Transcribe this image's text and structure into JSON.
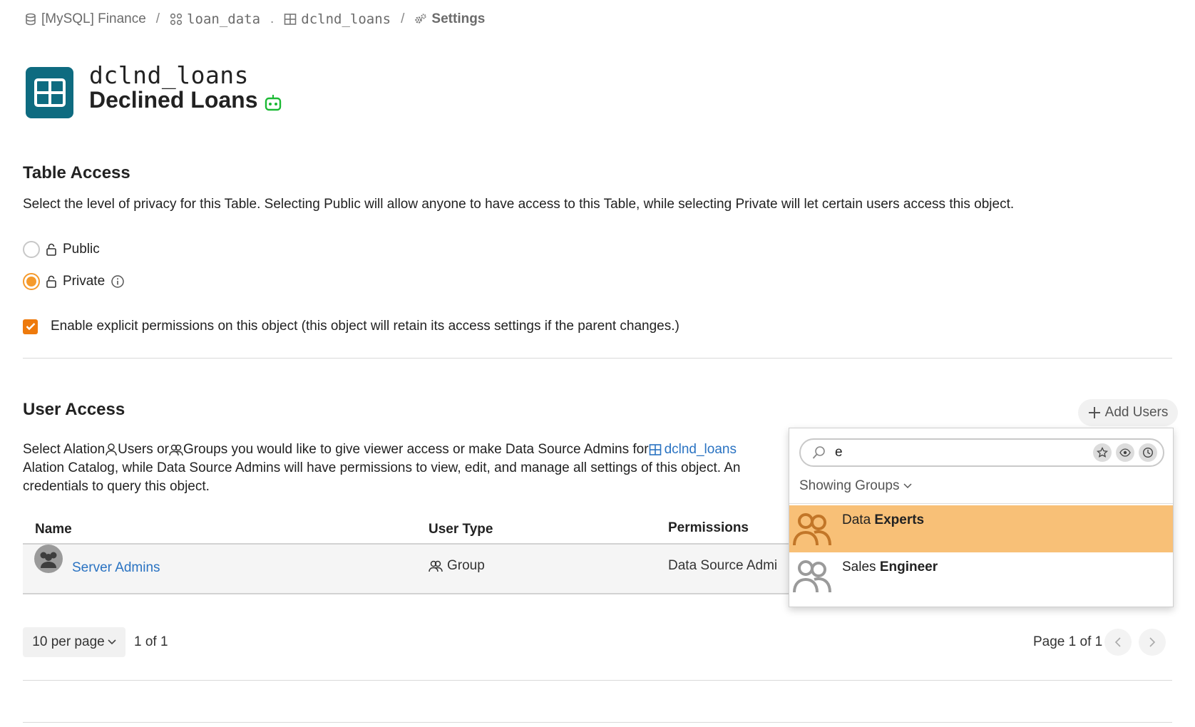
{
  "breadcrumb": {
    "datasource": "[MySQL] Finance",
    "schema": "loan_data",
    "dot": ".",
    "table": "dclnd_loans",
    "current": "Settings",
    "sep": "/"
  },
  "header": {
    "tech_name": "dclnd_loans",
    "title": "Declined Loans"
  },
  "table_access": {
    "heading": "Table Access",
    "description": "Select the level of privacy for this Table. Selecting Public will allow anyone to have access to this Table, while selecting Private will let certain users access this object.",
    "public_label": "Public",
    "private_label": "Private",
    "selected": "Private",
    "explicit_label": "Enable explicit permissions on this object (this object will retain its access settings if the parent changes.)",
    "explicit_checked": true
  },
  "user_access": {
    "heading": "User Access",
    "add_users": "Add Users",
    "desc_part1": "Select Alation ",
    "desc_users": "Users or ",
    "desc_groups": "Groups you would like to give viewer access or make Data Source Admins for ",
    "desc_link": "dclnd_loans",
    "desc_line2": "Alation Catalog, while Data Source Admins will have permissions to view, edit, and manage all settings of this object. An",
    "desc_line3": "credentials to query this object.",
    "columns": {
      "name": "Name",
      "user_type": "User Type",
      "permissions": "Permissions"
    },
    "rows": [
      {
        "name": "Server Admins",
        "user_type": "Group",
        "permissions": "Data Source Admi"
      }
    ],
    "per_page": "10 per page",
    "count": "1 of 1",
    "page": "Page 1 of 1"
  },
  "dropdown": {
    "search_value": "e",
    "showing": "Showing Groups",
    "options": [
      {
        "pre": "Data ",
        "bold": "Experts",
        "highlighted": true
      },
      {
        "pre": "Sales ",
        "bold": "Engineer",
        "highlighted": false
      }
    ]
  },
  "colors": {
    "accent_orange": "#f59a2c",
    "highlight": "#f8c077",
    "tile": "#0e6b80",
    "link": "#2a73c2",
    "bot_green": "#1bb934"
  }
}
